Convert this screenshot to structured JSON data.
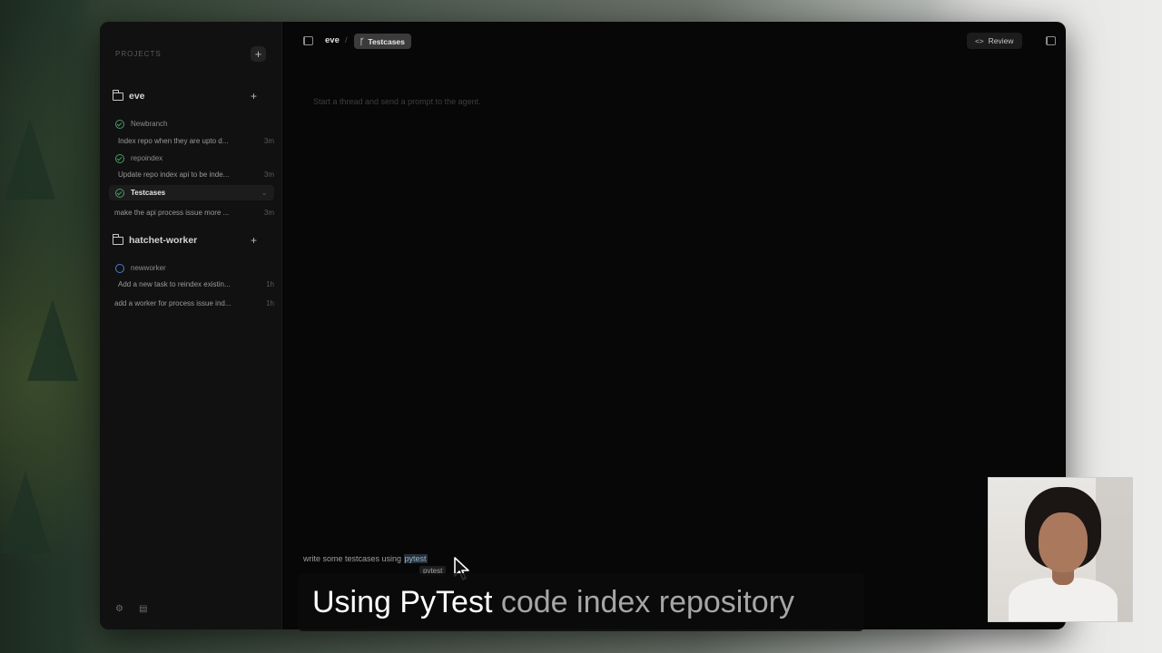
{
  "sidebar": {
    "header": "PROJECTS",
    "add_label": "+",
    "projects": [
      {
        "name": "eve",
        "add_label": "+",
        "branches": [
          {
            "name": "Newbranch",
            "status": "done",
            "thread": "Index repo when they are upto d...",
            "time": "3m"
          },
          {
            "name": "repoindex",
            "status": "done",
            "thread": "Update repo index api to be inde...",
            "time": "3m"
          },
          {
            "name": "Testcases",
            "status": "done",
            "active": true,
            "thread": "make the api process issue more ...",
            "time": "3m"
          }
        ]
      },
      {
        "name": "hatchet-worker",
        "add_label": "+",
        "branches": [
          {
            "name": "newworker",
            "status": "open",
            "thread": "Add a new task to reindex existin...",
            "time": "1h"
          }
        ],
        "extra_thread": {
          "text": "add a worker for process issue ind...",
          "time": "1h"
        }
      }
    ],
    "footer_icons": [
      "settings-icon",
      "archive-icon"
    ]
  },
  "topbar": {
    "breadcrumb_root": "eve",
    "separator": "/",
    "branch_tag": "Testcases",
    "review_label": "Review"
  },
  "main": {
    "empty_message": "Start a thread and send a prompt to the agent."
  },
  "composer": {
    "text_prefix": "write some testcases using ",
    "text_highlight": "pytest",
    "suggestion": "pytest"
  },
  "caption": {
    "part1": "Using PyTest",
    "part2": " code index repository"
  },
  "colors": {
    "window_bg": "#070707",
    "sidebar_bg": "#111111",
    "success": "#4a9a65",
    "open": "#4b7ecf",
    "tag_bg": "#3b3b3b"
  }
}
